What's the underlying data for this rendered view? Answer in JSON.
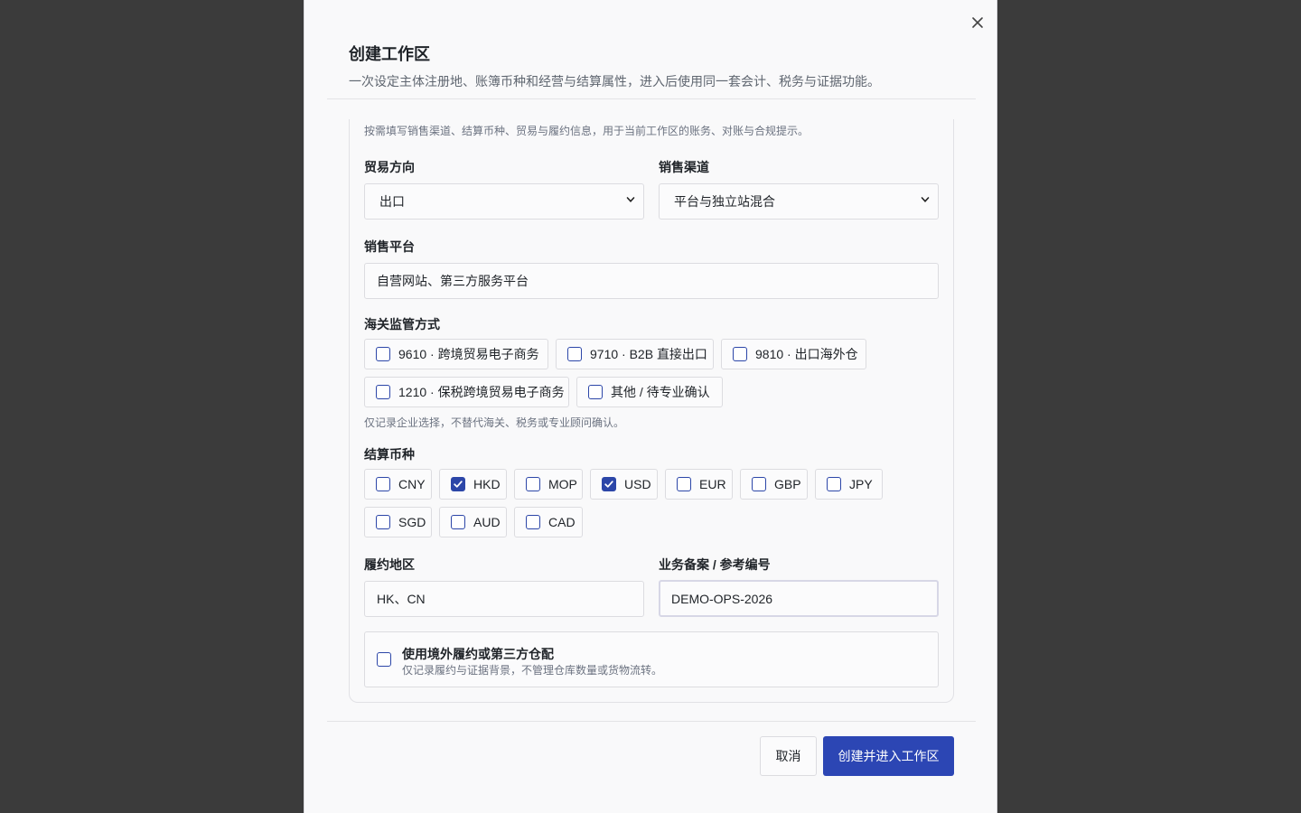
{
  "dialog": {
    "title": "创建工作区",
    "subtitle": "一次设定主体注册地、账簿币种和经营与结算属性，进入后使用同一套会计、税务与证据功能。",
    "close_icon": "close-icon"
  },
  "panel": {
    "hint": "按需填写销售渠道、结算币种、贸易与履约信息，用于当前工作区的账务、对账与合规提示。"
  },
  "trade_direction": {
    "label": "贸易方向",
    "value": "出口"
  },
  "sales_channel": {
    "label": "销售渠道",
    "value": "平台与独立站混合"
  },
  "sales_platform": {
    "label": "销售平台",
    "value": "自营网站、第三方服务平台"
  },
  "customs": {
    "label": "海关监管方式",
    "options": [
      {
        "label": "9610 · 跨境贸易电子商务",
        "checked": false
      },
      {
        "label": "9710 · B2B 直接出口",
        "checked": false
      },
      {
        "label": "9810 · 出口海外仓",
        "checked": false
      },
      {
        "label": "1210 · 保税跨境贸易电子商务",
        "checked": false
      },
      {
        "label": "其他 / 待专业确认",
        "checked": false
      }
    ],
    "note": "仅记录企业选择，不替代海关、税务或专业顾问确认。"
  },
  "currencies": {
    "label": "结算币种",
    "options": [
      {
        "label": "CNY",
        "checked": false
      },
      {
        "label": "HKD",
        "checked": true
      },
      {
        "label": "MOP",
        "checked": false
      },
      {
        "label": "USD",
        "checked": true
      },
      {
        "label": "EUR",
        "checked": false
      },
      {
        "label": "GBP",
        "checked": false
      },
      {
        "label": "JPY",
        "checked": false
      },
      {
        "label": "SGD",
        "checked": false
      },
      {
        "label": "AUD",
        "checked": false
      },
      {
        "label": "CAD",
        "checked": false
      }
    ]
  },
  "fulfillment_region": {
    "label": "履约地区",
    "value": "HK、CN"
  },
  "reference_no": {
    "label": "业务备案 / 参考编号",
    "value": "DEMO-OPS-2026"
  },
  "overseas_option": {
    "title": "使用境外履约或第三方仓配",
    "desc": "仅记录履约与证据背景，不管理仓库数量或货物流转。",
    "checked": false
  },
  "footer": {
    "cancel_label": "取消",
    "submit_label": "创建并进入工作区"
  },
  "colors": {
    "accent": "#2c46b4",
    "backdrop": "#3b3b3b",
    "dialog_bg": "#f9f9fa"
  }
}
